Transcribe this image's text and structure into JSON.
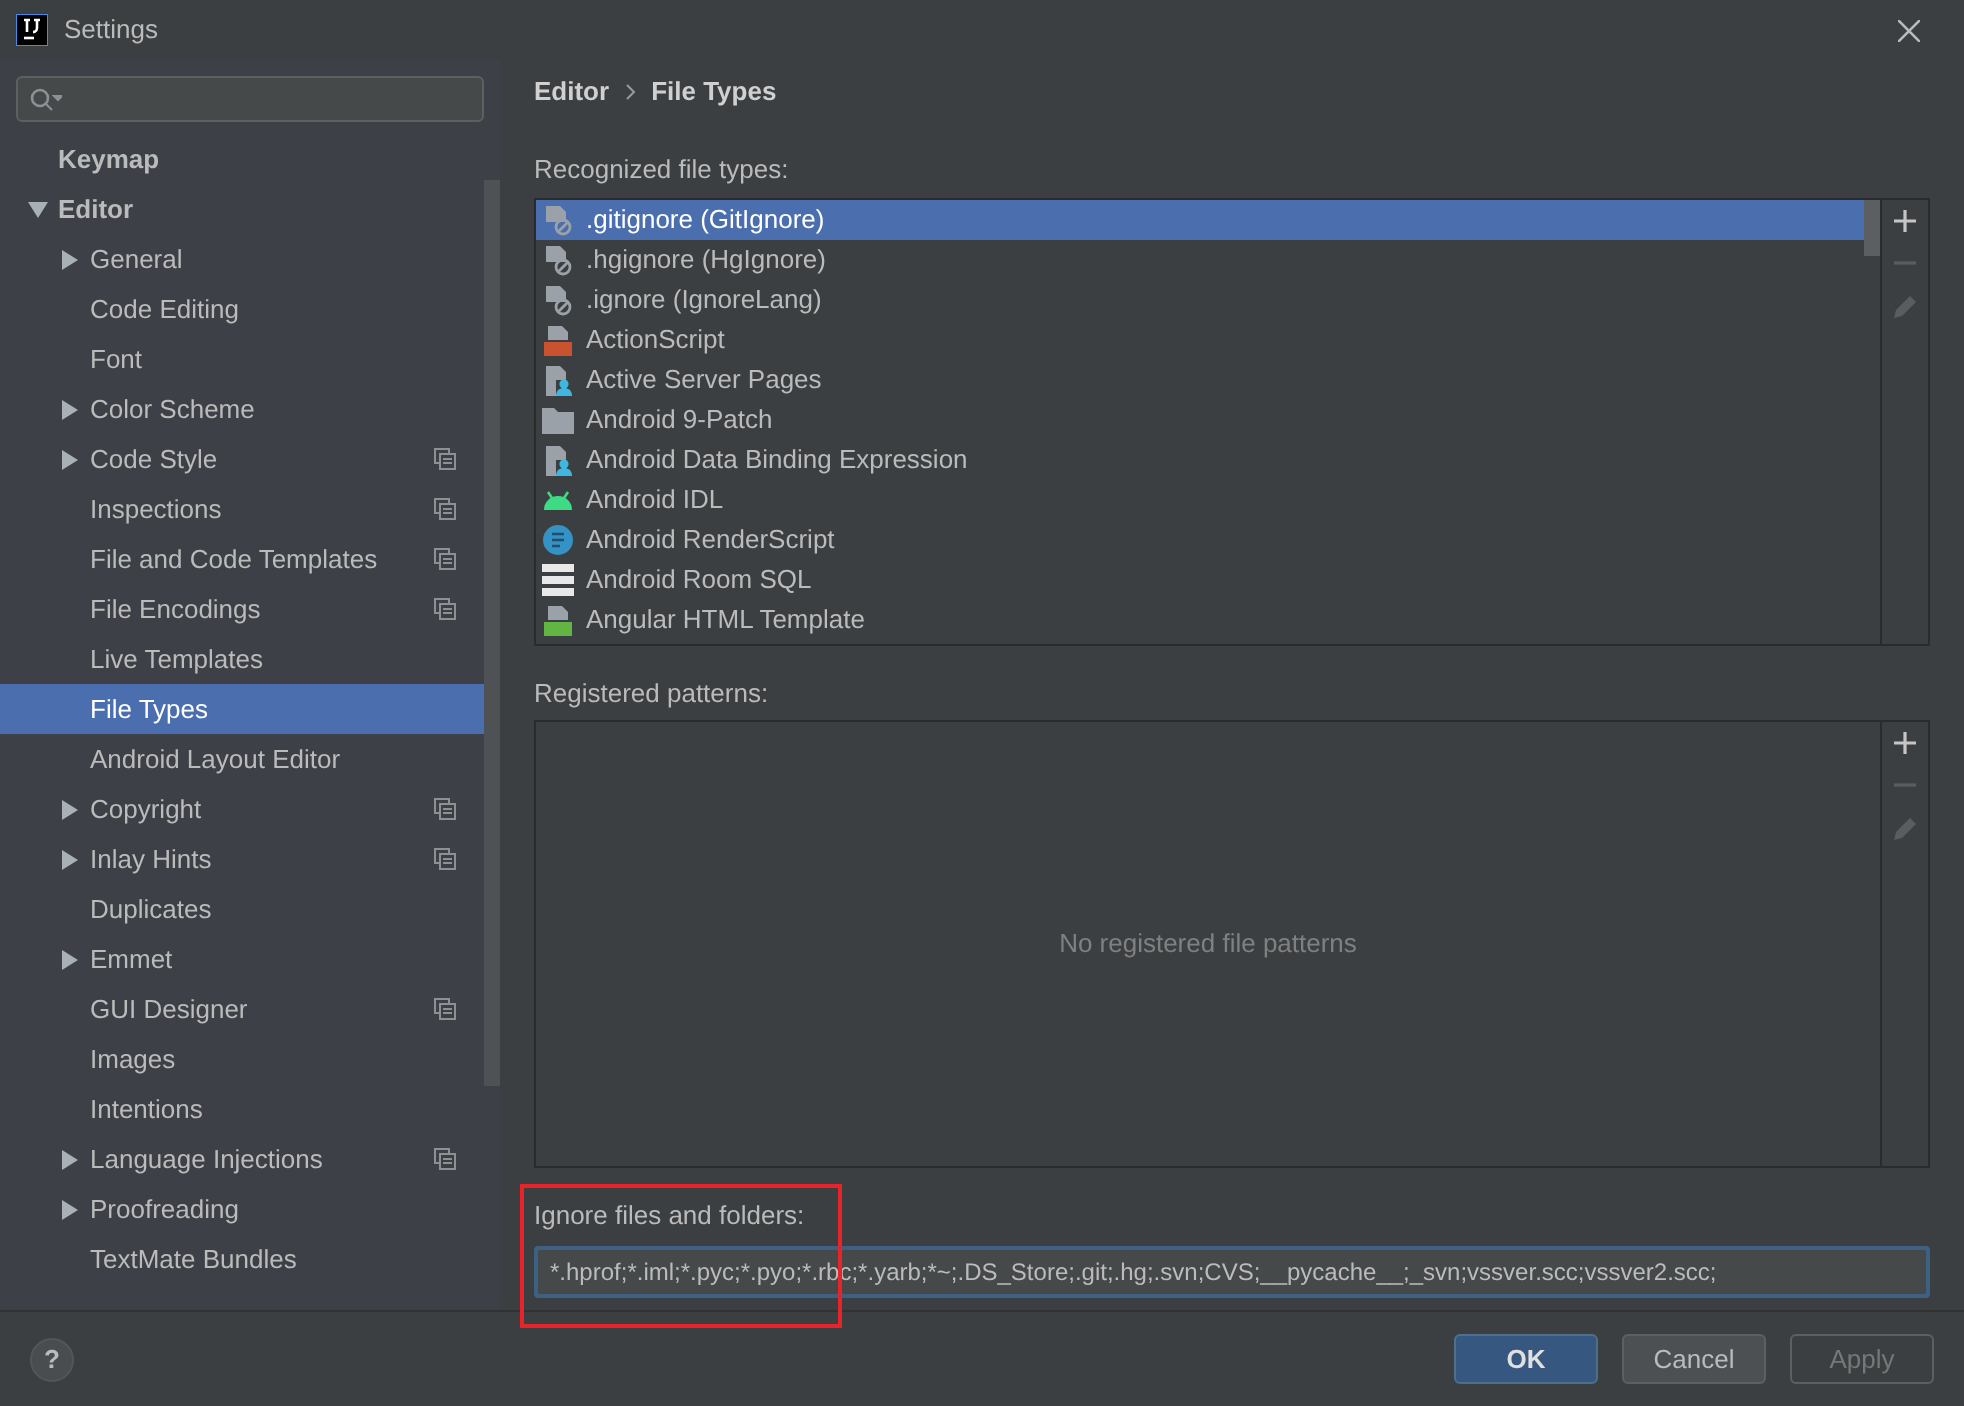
{
  "window": {
    "title": "Settings"
  },
  "sidebar": {
    "items": [
      {
        "label": "Keymap",
        "selected": false
      },
      {
        "label": "Editor",
        "selected": false,
        "expanded": true,
        "children": [
          {
            "label": "General",
            "expanded": false,
            "selected": false,
            "project_icon": false
          },
          {
            "label": "Code Editing",
            "selected": false,
            "project_icon": false
          },
          {
            "label": "Font",
            "selected": false,
            "project_icon": false
          },
          {
            "label": "Color Scheme",
            "expanded": false,
            "selected": false,
            "project_icon": false
          },
          {
            "label": "Code Style",
            "expanded": false,
            "selected": false,
            "project_icon": true
          },
          {
            "label": "Inspections",
            "selected": false,
            "project_icon": true
          },
          {
            "label": "File and Code Templates",
            "selected": false,
            "project_icon": true
          },
          {
            "label": "File Encodings",
            "selected": false,
            "project_icon": true
          },
          {
            "label": "Live Templates",
            "selected": false,
            "project_icon": false
          },
          {
            "label": "File Types",
            "selected": true,
            "project_icon": false
          },
          {
            "label": "Android Layout Editor",
            "selected": false,
            "project_icon": false
          },
          {
            "label": "Copyright",
            "expanded": false,
            "selected": false,
            "project_icon": true
          },
          {
            "label": "Inlay Hints",
            "expanded": false,
            "selected": false,
            "project_icon": true
          },
          {
            "label": "Duplicates",
            "selected": false,
            "project_icon": false
          },
          {
            "label": "Emmet",
            "expanded": false,
            "selected": false,
            "project_icon": false
          },
          {
            "label": "GUI Designer",
            "selected": false,
            "project_icon": true
          },
          {
            "label": "Images",
            "selected": false,
            "project_icon": false
          },
          {
            "label": "Intentions",
            "selected": false,
            "project_icon": false
          },
          {
            "label": "Language Injections",
            "expanded": false,
            "selected": false,
            "project_icon": true
          },
          {
            "label": "Proofreading",
            "expanded": false,
            "selected": false,
            "project_icon": false
          },
          {
            "label": "TextMate Bundles",
            "selected": false,
            "project_icon": false
          }
        ]
      }
    ]
  },
  "breadcrumb": [
    "Editor",
    "File Types"
  ],
  "recognized": {
    "label": "Recognized file types:",
    "items": [
      {
        "label": ".gitignore (GitIgnore)",
        "kind": "ignore",
        "selected": true
      },
      {
        "label": ".hgignore (HgIgnore)",
        "kind": "ignore",
        "selected": false
      },
      {
        "label": ".ignore (IgnoreLang)",
        "kind": "ignore",
        "selected": false
      },
      {
        "label": "ActionScript",
        "kind": "actionscript",
        "selected": false
      },
      {
        "label": "Active Server Pages",
        "kind": "person-file",
        "selected": false
      },
      {
        "label": "Android 9-Patch",
        "kind": "folder",
        "selected": false
      },
      {
        "label": "Android Data Binding Expression",
        "kind": "person-file",
        "selected": false
      },
      {
        "label": "Android IDL",
        "kind": "android",
        "selected": false
      },
      {
        "label": "Android RenderScript",
        "kind": "renderscript",
        "selected": false
      },
      {
        "label": "Android Room SQL",
        "kind": "table",
        "selected": false
      },
      {
        "label": "Angular HTML Template",
        "kind": "html",
        "selected": false
      }
    ]
  },
  "patterns": {
    "label": "Registered patterns:",
    "empty_text": "No registered file patterns"
  },
  "ignore": {
    "label": "Ignore files and folders:",
    "value": "*.hprof;*.iml;*.pyc;*.pyo;*.rbc;*.yarb;*~;.DS_Store;.git;.hg;.svn;CVS;__pycache__;_svn;vssver.scc;vssver2.scc;"
  },
  "help": "?",
  "buttons": [
    {
      "label": "OK",
      "kind": "primary",
      "disabled": false
    },
    {
      "label": "Cancel",
      "kind": "normal",
      "disabled": false
    },
    {
      "label": "Apply",
      "kind": "normal",
      "disabled": true
    }
  ]
}
